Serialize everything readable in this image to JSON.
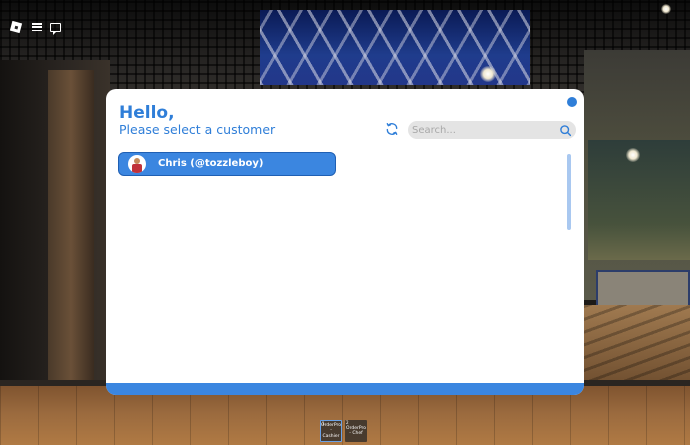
{
  "dialog": {
    "greeting": "Hello,",
    "subtitle": "Please select a customer",
    "search_placeholder": "Search...",
    "refresh_icon": "refresh-icon",
    "search_icon": "search-icon"
  },
  "customers": [
    {
      "label": "Chris (@tozzleboy)"
    }
  ],
  "hotbar": {
    "slots": [
      {
        "number": "1",
        "label": "OrderPro - Cashier",
        "selected": true
      },
      {
        "number": "2",
        "label": "OrderPro - Chef",
        "selected": false
      }
    ]
  },
  "topbar": {
    "icons": [
      "roblox-icon",
      "menu-icon",
      "chat-icon"
    ]
  },
  "colors": {
    "accent": "#2f7ed8",
    "button": "#3b86e0",
    "search_bg": "#e4e4e4"
  }
}
